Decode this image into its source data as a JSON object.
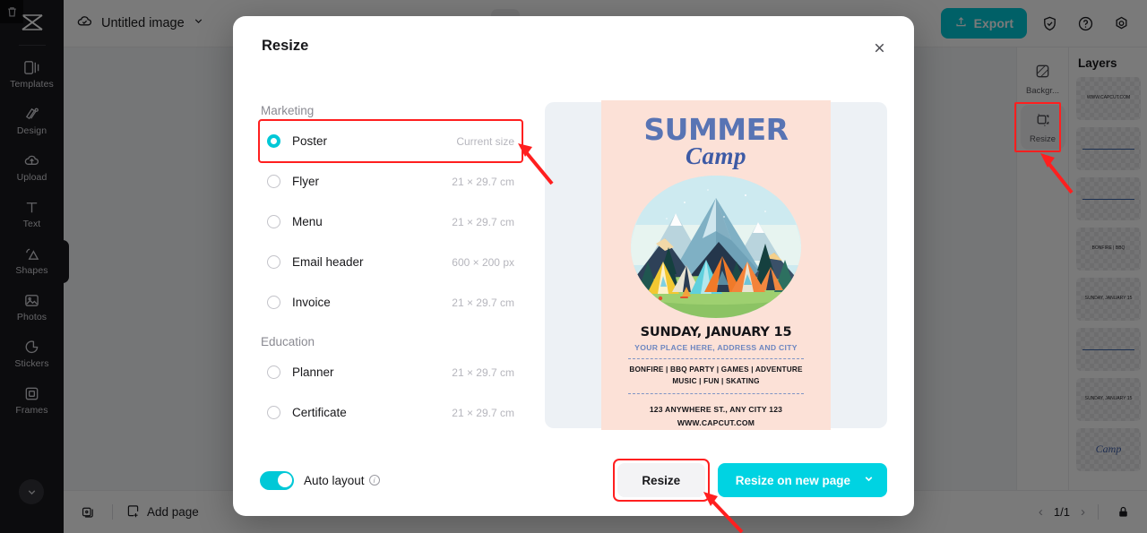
{
  "app": {
    "logo": "capcut-logo",
    "document_name": "Untitled image",
    "export_label": "Export"
  },
  "sidebar": {
    "items": [
      {
        "label": "Templates",
        "icon": "templates-icon"
      },
      {
        "label": "Design",
        "icon": "design-icon"
      },
      {
        "label": "Upload",
        "icon": "upload-cloud-icon"
      },
      {
        "label": "Text",
        "icon": "text-icon"
      },
      {
        "label": "Shapes",
        "icon": "shapes-icon"
      },
      {
        "label": "Photos",
        "icon": "photos-icon"
      },
      {
        "label": "Stickers",
        "icon": "stickers-icon"
      },
      {
        "label": "Frames",
        "icon": "frames-icon"
      }
    ],
    "collapse_icon": "chevron-down-icon"
  },
  "right_tools": {
    "items": [
      {
        "label": "Backgr...",
        "icon": "background-icon",
        "highlighted": false
      },
      {
        "label": "Resize",
        "icon": "resize-icon",
        "highlighted": true
      }
    ]
  },
  "layers": {
    "title": "Layers",
    "thumbs": [
      {
        "kind": "text",
        "text": "WWW.CAPCUT.COM"
      },
      {
        "kind": "rule",
        "text": ""
      },
      {
        "kind": "rule",
        "text": ""
      },
      {
        "kind": "text",
        "text": "BONFIRE | BBQ"
      },
      {
        "kind": "text",
        "text": "SUNDAY, JANUARY 15"
      },
      {
        "kind": "rule",
        "text": ""
      },
      {
        "kind": "text",
        "text": "SUNDAY, JANUARY 15"
      },
      {
        "kind": "script",
        "text": "Camp"
      }
    ]
  },
  "bottombar": {
    "duplicate_icon": "duplicate-page-icon",
    "delete_icon": "trash-icon",
    "add_page_label": "Add page",
    "add_page_icon": "add-page-icon",
    "page_indicator": "1/1",
    "prev_icon": "chevron-left-icon",
    "next_icon": "chevron-right-icon",
    "lock_icon": "unlock-icon"
  },
  "modal": {
    "title": "Resize",
    "close_icon": "close-icon",
    "groups": [
      {
        "title": "Marketing",
        "options": [
          {
            "label": "Poster",
            "size": "Current size",
            "selected": true,
            "highlighted": true
          },
          {
            "label": "Flyer",
            "size": "21 × 29.7 cm",
            "selected": false,
            "highlighted": false
          },
          {
            "label": "Menu",
            "size": "21 × 29.7 cm",
            "selected": false,
            "highlighted": false
          },
          {
            "label": "Email header",
            "size": "600 × 200 px",
            "selected": false,
            "highlighted": false
          },
          {
            "label": "Invoice",
            "size": "21 × 29.7 cm",
            "selected": false,
            "highlighted": false
          }
        ]
      },
      {
        "title": "Education",
        "options": [
          {
            "label": "Planner",
            "size": "21 × 29.7 cm",
            "selected": false,
            "highlighted": false
          },
          {
            "label": "Certificate",
            "size": "21 × 29.7 cm",
            "selected": false,
            "highlighted": false
          }
        ]
      }
    ],
    "auto_layout_label": "Auto layout",
    "auto_layout_on": true,
    "info_icon": "info-icon",
    "resize_button": "Resize",
    "resize_new_page_button": "Resize on new page",
    "dropdown_icon": "chevron-down-icon"
  },
  "poster": {
    "title": "SUMMER",
    "subtitle": "Camp",
    "date": "SUNDAY, JANUARY 15",
    "place": "YOUR PLACE HERE, ADDRESS AND CITY",
    "activities_line1": "BONFIRE | BBQ PARTY | GAMES | ADVENTURE",
    "activities_line2": "MUSIC | FUN | SKATING",
    "address": "123 ANYWHERE ST., ANY CITY 123",
    "website": "WWW.CAPCUT.COM"
  },
  "colors": {
    "accent_cyan": "#00d3e2",
    "highlight_red": "#ff1f1f",
    "poster_bg": "#fce1d7",
    "poster_blue": "#5874b4",
    "preview_bg": "#edf1f5"
  }
}
